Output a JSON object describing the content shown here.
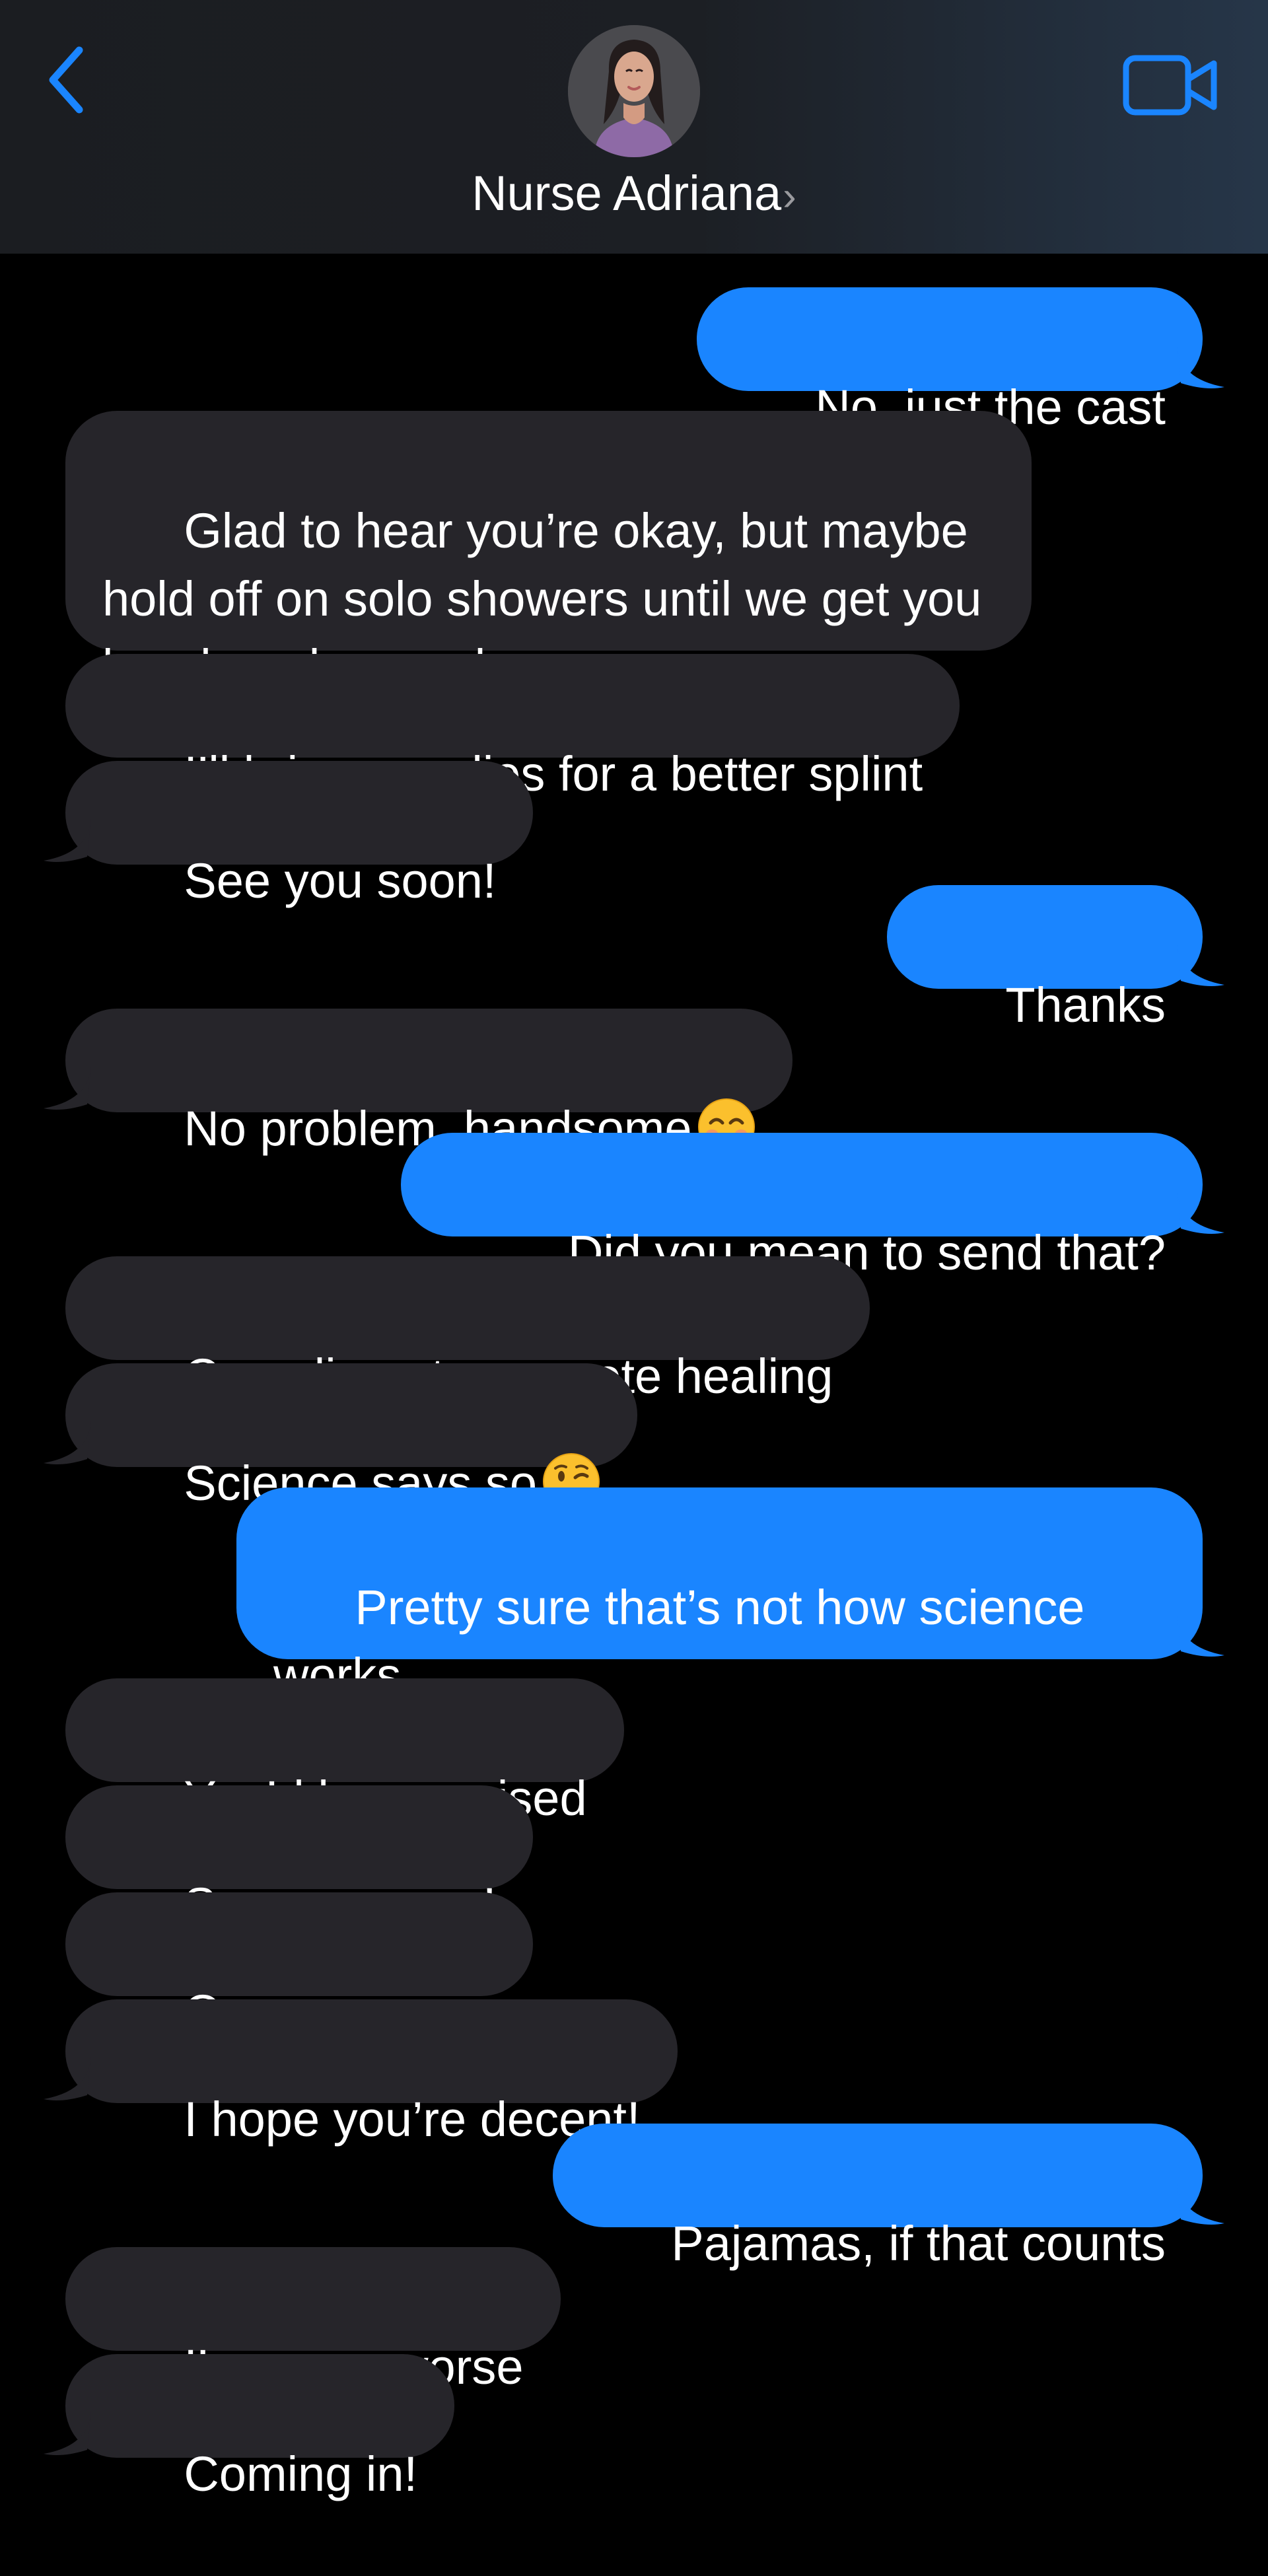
{
  "header": {
    "contact_name": "Nurse Adriana",
    "name_chevron": "›",
    "back_icon": "chevron-left-icon",
    "video_icon": "video-camera-icon",
    "accent_color": "#1a85ff",
    "header_bg": "#1c1f24"
  },
  "colors": {
    "incoming_bubble": "#26252a",
    "outgoing_bubble": "#1a85ff",
    "background": "#000000"
  },
  "messages": [
    {
      "from": "me",
      "text": "No, just the cast"
    },
    {
      "from": "them",
      "text": "Glad to hear you’re okay, but maybe hold off on solo showers until we get you bandaged properly"
    },
    {
      "from": "them",
      "text": "I’ll bring supplies for a better splint"
    },
    {
      "from": "them",
      "text": "See you soon!"
    },
    {
      "from": "me",
      "text": "Thanks"
    },
    {
      "from": "them",
      "text": "No problem, handsome",
      "emoji": "smiling-face-icon"
    },
    {
      "from": "me",
      "text": "…Did you mean to send that?"
    },
    {
      "from": "them",
      "text": "Compliments promote healing"
    },
    {
      "from": "them",
      "text": "Science says so",
      "emoji": "winking-face-icon"
    },
    {
      "from": "me",
      "text": "Pretty sure that’s not how science works"
    },
    {
      "from": "them",
      "text": "You’d be surprised"
    },
    {
      "from": "them",
      "text": "See you soon!"
    },
    {
      "from": "them",
      "text": "On my way up"
    },
    {
      "from": "them",
      "text": "I hope you’re decent!"
    },
    {
      "from": "me",
      "text": "Pajamas, if that counts"
    },
    {
      "from": "them",
      "text": "I’ve seen worse"
    },
    {
      "from": "them",
      "text": "Coming in!"
    }
  ]
}
